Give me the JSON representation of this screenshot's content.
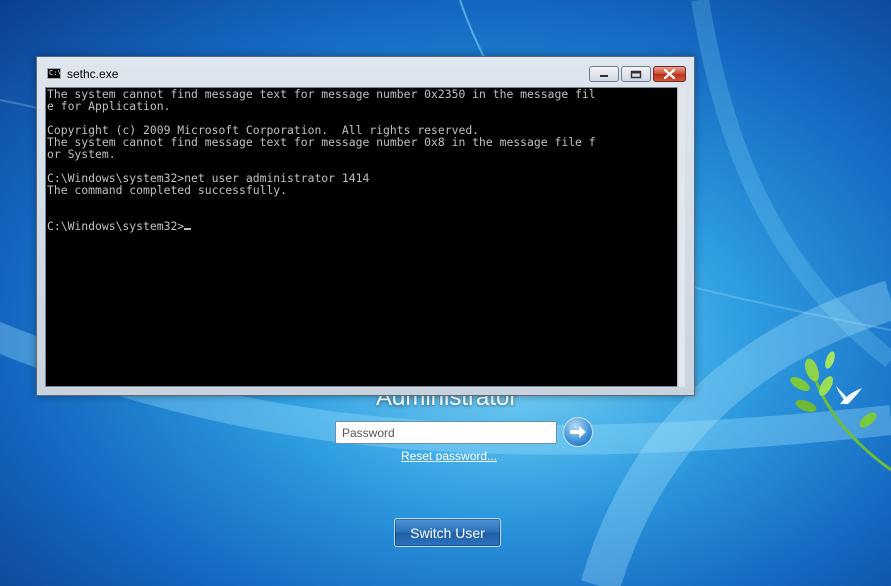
{
  "logon": {
    "user_name": "Administrator",
    "password_placeholder": "Password",
    "reset_password": "Reset password...",
    "switch_user": "Switch User",
    "go_icon": "arrow-right-icon"
  },
  "console": {
    "title": "sethc.exe",
    "icon": "console-icon",
    "icon_text": "C:\\",
    "lines": [
      "The system cannot find message text for message number 0x2350 in the message fil",
      "e for Application.",
      "",
      "Copyright (c) 2009 Microsoft Corporation.  All rights reserved.",
      "The system cannot find message text for message number 0x8 in the message file f",
      "or System.",
      "",
      "C:\\Windows\\system32>net user administrator 1414",
      "The command completed successfully.",
      "",
      ""
    ],
    "prompt": "C:\\Windows\\system32>"
  },
  "colors": {
    "terminal_bg": "#000000",
    "terminal_fg": "#c0c0c0",
    "close_button": "#c94a31",
    "wallpaper": "#2a9be0"
  }
}
